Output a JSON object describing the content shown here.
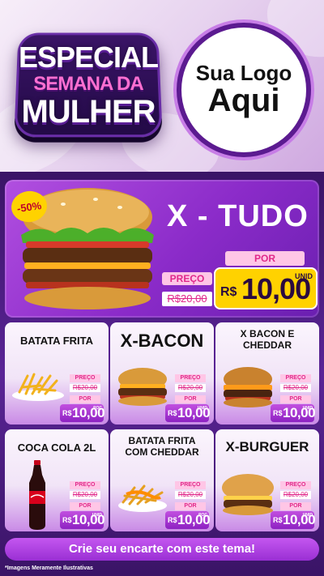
{
  "badge": {
    "line1": "ESPECIAL",
    "line2": "SEMANA DA",
    "line3": "MULHER"
  },
  "logo": {
    "line1": "Sua Logo",
    "line2": "Aqui"
  },
  "hero": {
    "title": "X - TUDO",
    "discount": "-50%",
    "preco_label": "PREÇO",
    "old_price": "R$20,00",
    "por_label": "POR",
    "currency": "R$",
    "price": "10,00",
    "unit": "UNID"
  },
  "products": [
    {
      "name": "BATATA FRITA",
      "preco_label": "PREÇO",
      "old_price": "R$20,00",
      "por_label": "POR",
      "currency": "R$",
      "price": "10,00",
      "unit": "POÇ"
    },
    {
      "name": "X-BACON",
      "preco_label": "PREÇO",
      "old_price": "R$20,00",
      "por_label": "POR",
      "currency": "R$",
      "price": "10,00",
      "unit": "UNID"
    },
    {
      "name": "X BACON E CHEDDAR",
      "preco_label": "PREÇO",
      "old_price": "R$20,00",
      "por_label": "POR",
      "currency": "R$",
      "price": "10,00",
      "unit": "UNID"
    },
    {
      "name": "COCA COLA 2L",
      "preco_label": "PREÇO",
      "old_price": "R$20,00",
      "por_label": "POR",
      "currency": "R$",
      "price": "10,00",
      "unit": "UNID"
    },
    {
      "name": "BATATA FRITA COM CHEDDAR",
      "preco_label": "PREÇO",
      "old_price": "R$20,00",
      "por_label": "POR",
      "currency": "R$",
      "price": "10,00",
      "unit": "POÇ"
    },
    {
      "name": "X-BURGUER",
      "preco_label": "PREÇO",
      "old_price": "R$20,00",
      "por_label": "POR",
      "currency": "R$",
      "price": "10,00",
      "unit": "UNID"
    }
  ],
  "cta": "Crie seu encarte com este tema!",
  "footer_note": "*Imagens Meramente Ilustrativas",
  "colors": {
    "purple_dark": "#3a1466",
    "purple": "#8b2bc9",
    "pink": "#e0288a",
    "yellow": "#ffd200"
  }
}
